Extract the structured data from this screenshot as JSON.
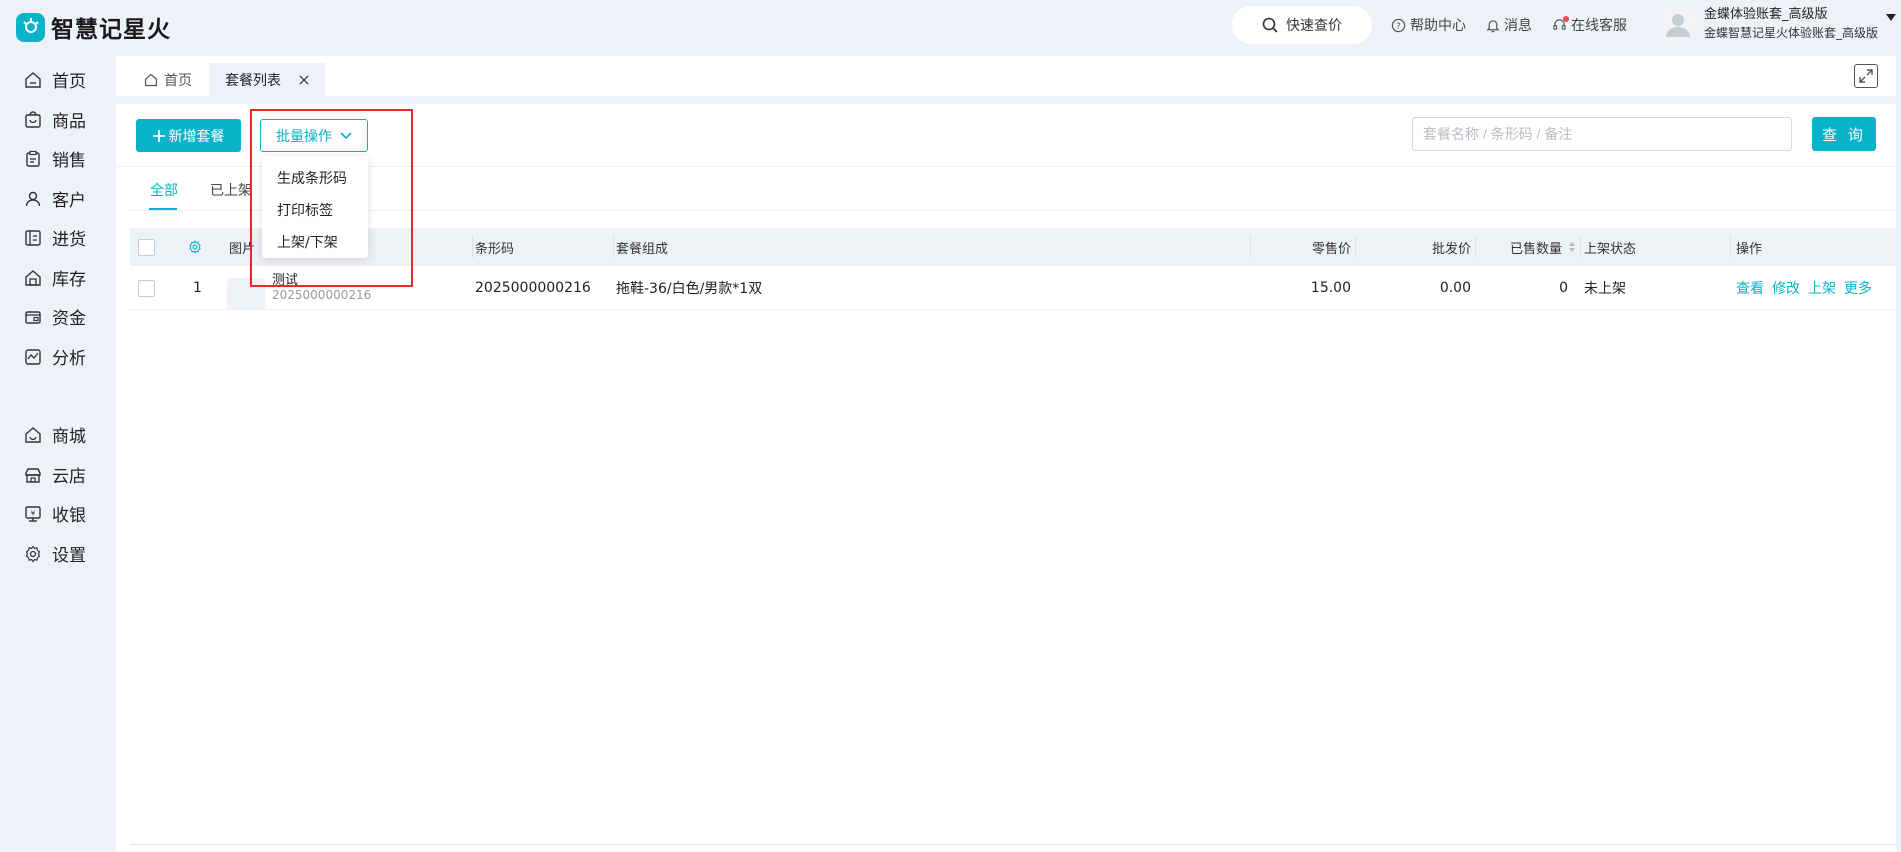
{
  "app": {
    "name": "智慧记星火"
  },
  "topbar": {
    "quick_price": "快速查价",
    "help": "帮助中心",
    "messages": "消息",
    "service": "在线客服",
    "user_name": "金蝶体验账套_高级版",
    "user_account": "金蝶智慧记星火体验账套_高级版"
  },
  "sidebar": {
    "items": [
      {
        "label": "首页",
        "icon": "home-icon"
      },
      {
        "label": "商品",
        "icon": "product-icon"
      },
      {
        "label": "销售",
        "icon": "sales-icon"
      },
      {
        "label": "客户",
        "icon": "customer-icon"
      },
      {
        "label": "进货",
        "icon": "purchase-icon"
      },
      {
        "label": "库存",
        "icon": "inventory-icon"
      },
      {
        "label": "资金",
        "icon": "wallet-icon"
      },
      {
        "label": "分析",
        "icon": "analysis-icon"
      },
      {
        "label": "商城",
        "icon": "mall-icon"
      },
      {
        "label": "云店",
        "icon": "store-icon"
      },
      {
        "label": "收银",
        "icon": "cashier-icon"
      },
      {
        "label": "设置",
        "icon": "gear-icon"
      }
    ]
  },
  "tabs": [
    {
      "label": "首页"
    },
    {
      "label": "套餐列表"
    }
  ],
  "toolbar": {
    "new_label": "新增套餐",
    "batch_label": "批量操作",
    "search_placeholder": "套餐名称 / 条形码 / 备注",
    "query_label": "查 询"
  },
  "filter_tabs": [
    "全部",
    "已上架"
  ],
  "dropdown": {
    "items": [
      "生成条形码",
      "打印标签",
      "上架/下架"
    ]
  },
  "table": {
    "headers": {
      "image": "图片",
      "barcode": "条形码",
      "composition": "套餐组成",
      "retail": "零售价",
      "wholesale": "批发价",
      "sold": "已售数量",
      "status": "上架状态",
      "ops": "操作"
    },
    "rows": [
      {
        "index": "1",
        "name": "测试",
        "code": "2025000000216",
        "barcode": "2025000000216",
        "composition": "拖鞋-36/白色/男款*1双",
        "retail": "15.00",
        "wholesale": "0.00",
        "sold": "0",
        "status": "未上架",
        "actions": [
          "查看",
          "修改",
          "上架",
          "更多"
        ]
      }
    ]
  },
  "colors": {
    "accent": "#0ab3c9",
    "highlight_box": "#e22b2b",
    "background": "#eef2f8"
  }
}
